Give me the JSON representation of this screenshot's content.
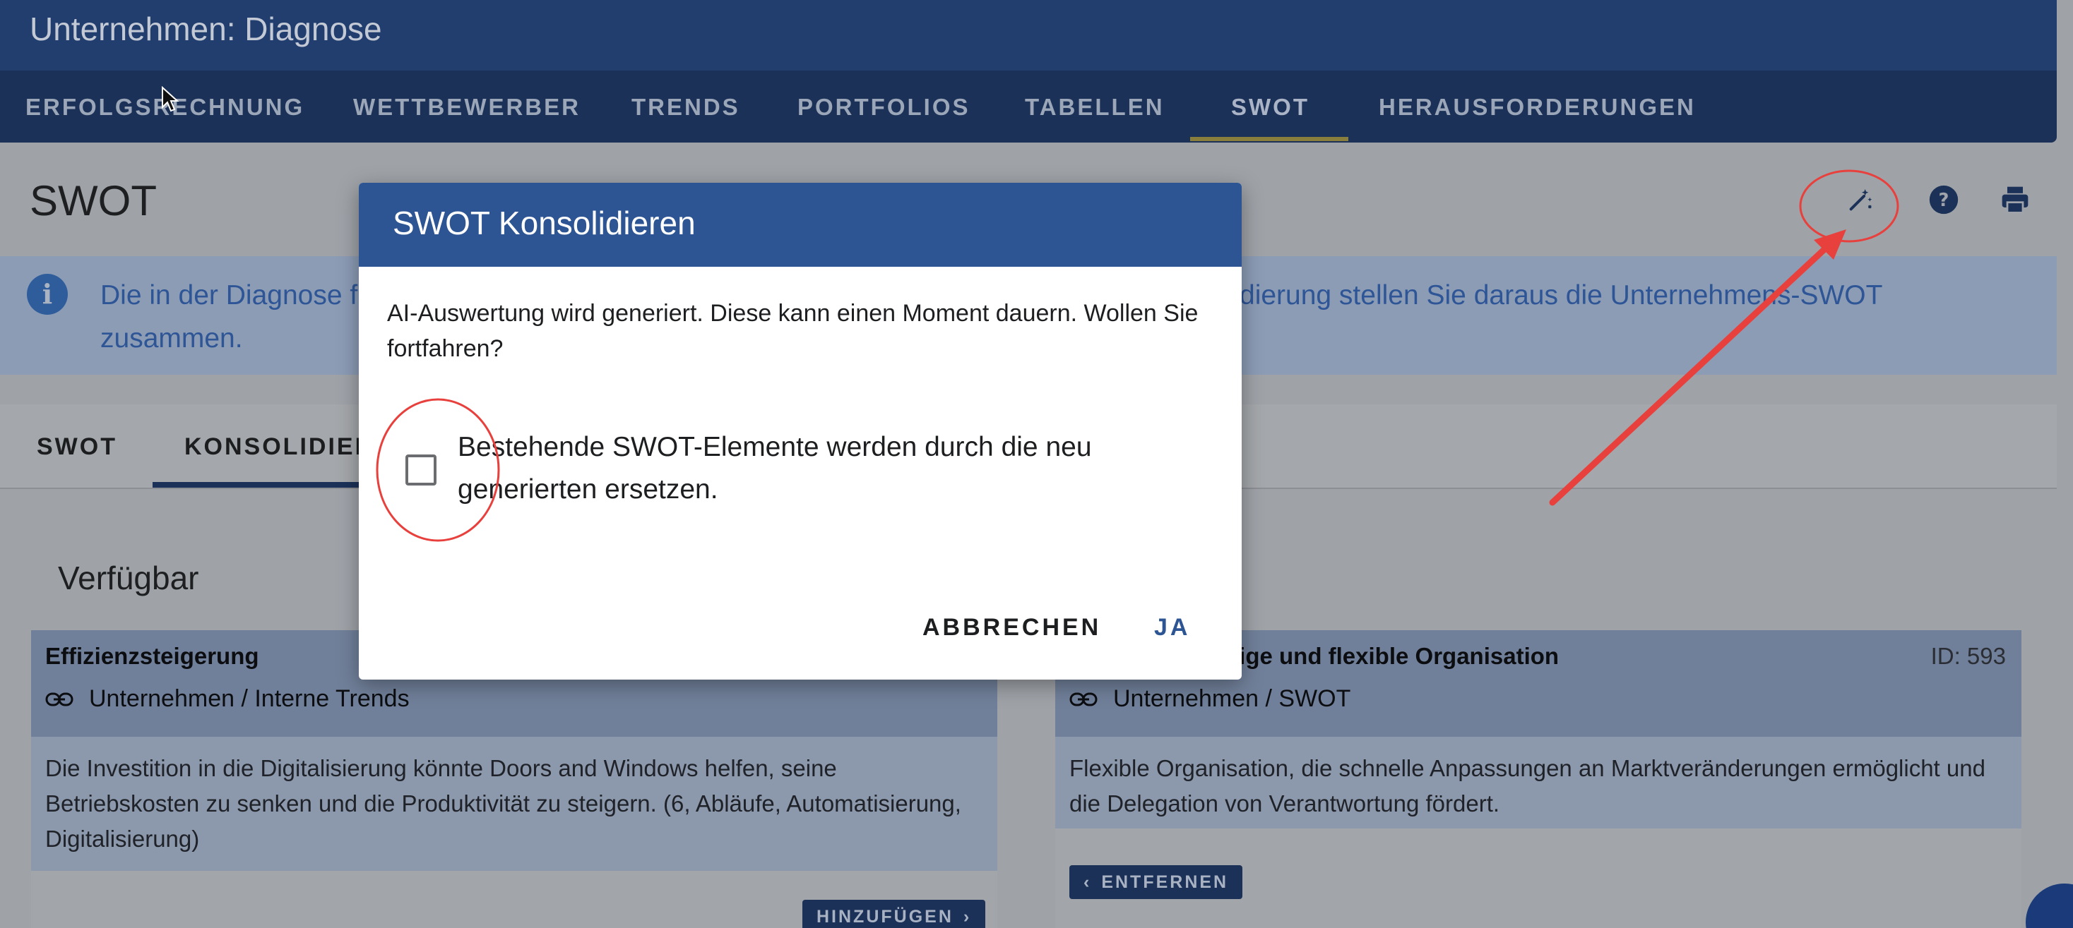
{
  "app": {
    "title": "Unternehmen: Diagnose"
  },
  "nav": {
    "items": [
      {
        "label": "ERFOLGSRECHNUNG"
      },
      {
        "label": "WETTBEWERBER"
      },
      {
        "label": "TRENDS"
      },
      {
        "label": "PORTFOLIOS"
      },
      {
        "label": "TABELLEN"
      },
      {
        "label": "SWOT"
      },
      {
        "label": "HERAUSFORDERUNGEN"
      }
    ],
    "active": "SWOT"
  },
  "page": {
    "title": "SWOT",
    "header_icons": [
      "magic-wand-icon",
      "help-icon",
      "print-icon"
    ]
  },
  "info": {
    "text_left": "Die in der Diagnose f",
    "text_right": "dierung stellen Sie daraus die Unternehmens-SWOT",
    "text_line2": "zusammen."
  },
  "tabs": [
    {
      "label": "SWOT"
    },
    {
      "label": "KONSOLIDIER"
    }
  ],
  "section": {
    "title": "Verfügbar"
  },
  "cards": [
    {
      "title": "Effizienzsteigerung",
      "id": "",
      "link": "Unternehmen / Interne Trends",
      "body": "Die Investition in die Digitalisierung könnte Doors and Windows helfen, seine Betriebskosten zu senken und die Produktivität zu steigern. (6, Abläufe, Automatisierung, Digitalisierung)",
      "button": "HINZUFÜGEN"
    },
    {
      "title": "nige und flexible Organisation",
      "id": "ID: 593",
      "link": "Unternehmen / SWOT",
      "body": "Flexible Organisation, die schnelle Anpassungen an Marktveränderungen ermöglicht und die Delegation von Verantwortung fördert.",
      "button": "ENTFERNEN"
    }
  ],
  "dialog": {
    "title": "SWOT Konsolidieren",
    "message": "AI-Auswertung wird generiert. Diese kann einen Moment dauern. Wollen Sie fortfahren?",
    "checkbox_label": "Bestehende SWOT-Elemente werden durch die neu generierten ersetzen.",
    "checkbox_checked": false,
    "cancel_label": "ABBRECHEN",
    "confirm_label": "JA"
  },
  "colors": {
    "primary": "#2d5594",
    "appbar": "#223e6e",
    "annotation": "#e8403c"
  }
}
